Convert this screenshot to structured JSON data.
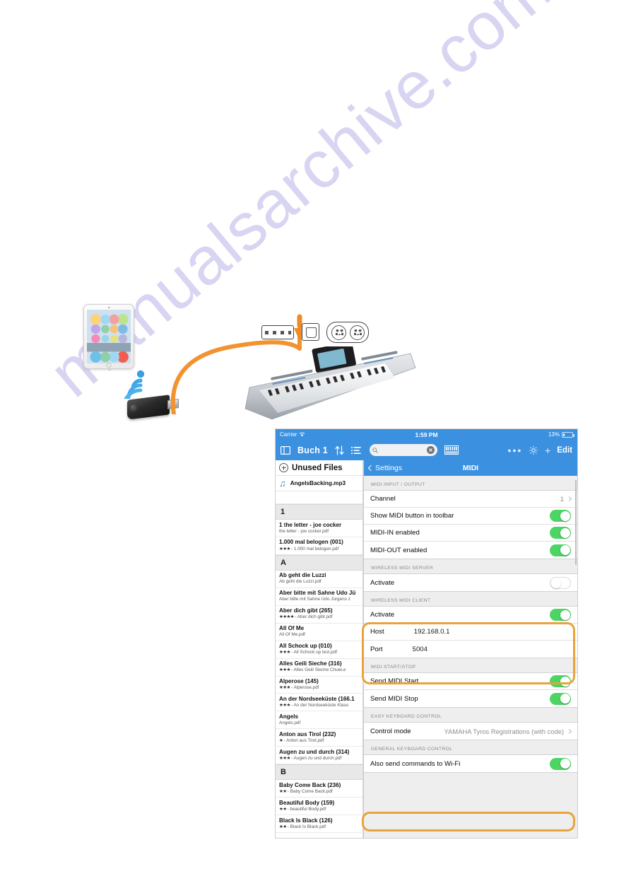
{
  "watermark": {
    "text": "manualsarchive.com"
  },
  "illustration": {
    "ipad_label": "ipad-device",
    "wifi_label": "wifi-signal",
    "dongle_label": "usb-wifi-dongle",
    "cable_label": "orange-usb-cable",
    "keyboard_label": "yamaha-tyros-keyboard",
    "ports": [
      "usb-a-port",
      "usb-b-port",
      "midi-din-ports"
    ]
  },
  "app": {
    "statusbar": {
      "carrier": "Carrier",
      "time": "1:59 PM",
      "battery": "13%"
    },
    "toolbar": {
      "book_title": "Buch 1",
      "edit_label": "Edit",
      "midi_label": "MIDI",
      "search_placeholder": "",
      "search_value": "",
      "icons": [
        "book-view-icon",
        "sort-icon",
        "list-icon",
        "search-icon",
        "clear-icon",
        "midi-icon",
        "more-icon",
        "gear-icon",
        "add-icon"
      ]
    },
    "filelist": {
      "unused_files": "Unused Files",
      "mp3": "AngelsBacking.mp3",
      "sections": [
        {
          "letter": "1",
          "files": [
            {
              "title": "1 the letter - joe cocker",
              "sub": "the letter - joe cocker.pdf",
              "stars": ""
            },
            {
              "title": "1.000 mal belogen (001)",
              "sub": "- 1.000 mal belogen.pdf",
              "stars": "★★★"
            }
          ]
        },
        {
          "letter": "A",
          "files": [
            {
              "title": "Ab geht die Luzzi",
              "sub": "Ab geht die Luzzi.pdf",
              "stars": ""
            },
            {
              "title": "Aber bitte mit Sahne Udo Jü",
              "sub": "Aber bitte mit Sahne Udo Jürgens z",
              "stars": ""
            },
            {
              "title": "Aber dich gibt (265)",
              "sub": "- Aber dich gibt.pdf",
              "stars": "★★★★"
            },
            {
              "title": "All Of Me",
              "sub": "All Of Me.pdf",
              "stars": ""
            },
            {
              "title": "All Schock up (010)",
              "sub": "- All Schock up test.pdf",
              "stars": "★★★"
            },
            {
              "title": "Alles Geili Sieche (316)",
              "sub": "- Alles Geili Sieche   ChueLe",
              "stars": "★★★"
            },
            {
              "title": "Alperose (145)",
              "sub": "- Alperose.pdf",
              "stars": "★★★"
            },
            {
              "title": "An der Nordseeküste (166.1",
              "sub": "- An der Nordseeküste Klaus",
              "stars": "★★★"
            },
            {
              "title": "Angels",
              "sub": "Angels.pdf",
              "stars": ""
            },
            {
              "title": "Anton aus Tirol (232)",
              "sub": "- Anton aus Tirol.pdf",
              "stars": "★"
            },
            {
              "title": "Augen zu und durch (314)",
              "sub": "- Augen zu und durch.pdf",
              "stars": "★★★"
            }
          ]
        },
        {
          "letter": "B",
          "files": [
            {
              "title": "Baby Come Back (236)",
              "sub": "- Baby Come Back.pdf",
              "stars": "★★"
            },
            {
              "title": "Beautiful Body (159)",
              "sub": "- beautiful Body.pdf",
              "stars": "★★"
            },
            {
              "title": "Black Is Black (126)",
              "sub": "- Black Is Black.pdf",
              "stars": "★★"
            }
          ]
        }
      ]
    },
    "settings": {
      "back_label": "Settings",
      "title": "MIDI",
      "groups": [
        {
          "header": "MIDI INPUT / OUTPUT",
          "rows": [
            {
              "label": "Channel",
              "type": "disclosure",
              "value": "1"
            },
            {
              "label": "Show MIDI button in toolbar",
              "type": "switch",
              "state": "on"
            },
            {
              "label": "MIDI-IN enabled",
              "type": "switch",
              "state": "on"
            },
            {
              "label": "MIDI-OUT enabled",
              "type": "switch",
              "state": "on"
            }
          ]
        },
        {
          "header": "WIRELESS MIDI SERVER",
          "rows": [
            {
              "label": "Activate",
              "type": "switch",
              "state": "off"
            }
          ]
        },
        {
          "header": "WIRELESS MIDI CLIENT",
          "highlighted": true,
          "rows": [
            {
              "label": "Activate",
              "type": "switch",
              "state": "on"
            },
            {
              "label": "Host",
              "type": "field",
              "value": "192.168.0.1"
            },
            {
              "label": "Port",
              "type": "field",
              "value": "5004"
            }
          ]
        },
        {
          "header": "MIDI START/STOP",
          "rows": [
            {
              "label": "Send MIDI Start",
              "type": "switch",
              "state": "on"
            },
            {
              "label": "Send MIDI Stop",
              "type": "switch",
              "state": "on"
            }
          ]
        },
        {
          "header": "EASY KEYBOARD CONTROL",
          "rows": [
            {
              "label": "Control mode",
              "type": "disclosure",
              "value": "YAMAHA Tyros Registrations (with code)"
            }
          ]
        },
        {
          "header": "GENERAL KEYBOARD CONTROL",
          "highlighted": true,
          "rows": [
            {
              "label": "Also send commands to Wi-Fi",
              "type": "switch",
              "state": "on"
            }
          ]
        }
      ]
    }
  },
  "colors": {
    "ios_blue": "#3b91e0",
    "switch_green": "#4cd464",
    "highlight_orange": "#e8a33d",
    "cable_orange": "#f29230",
    "watermark": "#d7d5f2"
  }
}
